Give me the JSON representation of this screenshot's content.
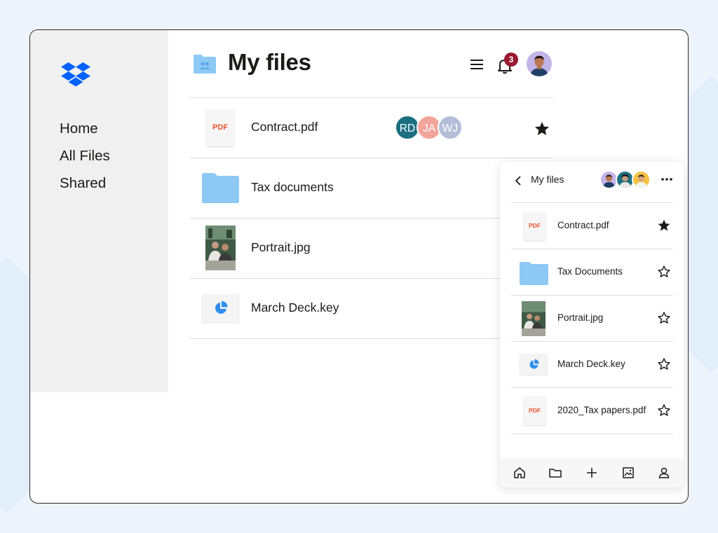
{
  "desktop": {
    "title": "My files",
    "nav": [
      {
        "label": "Home"
      },
      {
        "label": "All Files"
      },
      {
        "label": "Shared"
      }
    ],
    "notifications": {
      "count": "3"
    },
    "files": [
      {
        "name": "Contract.pdf",
        "type": "pdf",
        "thumb_label": "PDF",
        "starred": true,
        "collaborators": [
          {
            "initials": "RD",
            "color": "#1b6f80"
          },
          {
            "initials": "JA",
            "color": "#f2a39a"
          },
          {
            "initials": "WJ",
            "color": "#b3bfd8"
          }
        ]
      },
      {
        "name": "Tax documents",
        "type": "folder"
      },
      {
        "name": "Portrait.jpg",
        "type": "image"
      },
      {
        "name": "March Deck.key",
        "type": "keynote"
      }
    ]
  },
  "mobile": {
    "title": "My files",
    "files": [
      {
        "name": "Contract.pdf",
        "type": "pdf",
        "thumb_label": "PDF",
        "starred": true
      },
      {
        "name": "Tax Documents",
        "type": "folder",
        "starred": false
      },
      {
        "name": "Portrait.jpg",
        "type": "image",
        "starred": false
      },
      {
        "name": "March Deck.key",
        "type": "keynote",
        "starred": false
      },
      {
        "name": "2020_Tax papers.pdf",
        "type": "pdf",
        "thumb_label": "PDF",
        "starred": false
      }
    ],
    "tabbar": [
      "home-icon",
      "folder-icon",
      "plus-icon",
      "photos-icon",
      "account-icon"
    ]
  },
  "colors": {
    "brand": "#0061fe",
    "folder": "#8ec9f5",
    "pdf_label": "#e8532c",
    "badge": "#9a1830",
    "keynote": "#2f8ef0"
  }
}
